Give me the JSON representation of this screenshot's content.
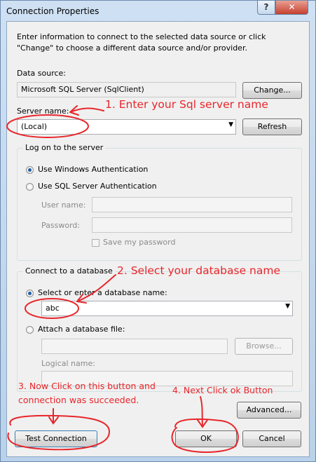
{
  "window": {
    "title": "Connection Properties",
    "help_glyph": "?",
    "close_glyph": "✕"
  },
  "intro": "Enter information to connect to the selected data source or click \"Change\" to choose a different data source and/or provider.",
  "data_source": {
    "label": "Data source:",
    "value": "Microsoft SQL Server (SqlClient)",
    "change_button": "Change..."
  },
  "server": {
    "label": "Server name:",
    "value": "(Local)",
    "refresh_button": "Refresh"
  },
  "logon": {
    "group_title": "Log on to the server",
    "windows_auth": "Use Windows Authentication",
    "sql_auth": "Use SQL Server Authentication",
    "selected": "windows",
    "user_name_label": "User name:",
    "password_label": "Password:",
    "save_password": "Save my password"
  },
  "database": {
    "group_title": "Connect to a database",
    "select_option": "Select or enter a database name:",
    "db_name": "abc",
    "attach_option": "Attach a database file:",
    "browse_button": "Browse...",
    "logical_name_label": "Logical name:"
  },
  "buttons": {
    "advanced": "Advanced...",
    "test_connection": "Test Connection",
    "ok": "OK",
    "cancel": "Cancel"
  },
  "annotations": {
    "step1": "1. Enter your Sql server name",
    "step2": "2. Select your database name",
    "step3_line1": "3. Now Click on this button and",
    "step3_line2": "connection was succeeded.",
    "step4": "4. Next Click ok Button",
    "color": "#e8262b"
  }
}
